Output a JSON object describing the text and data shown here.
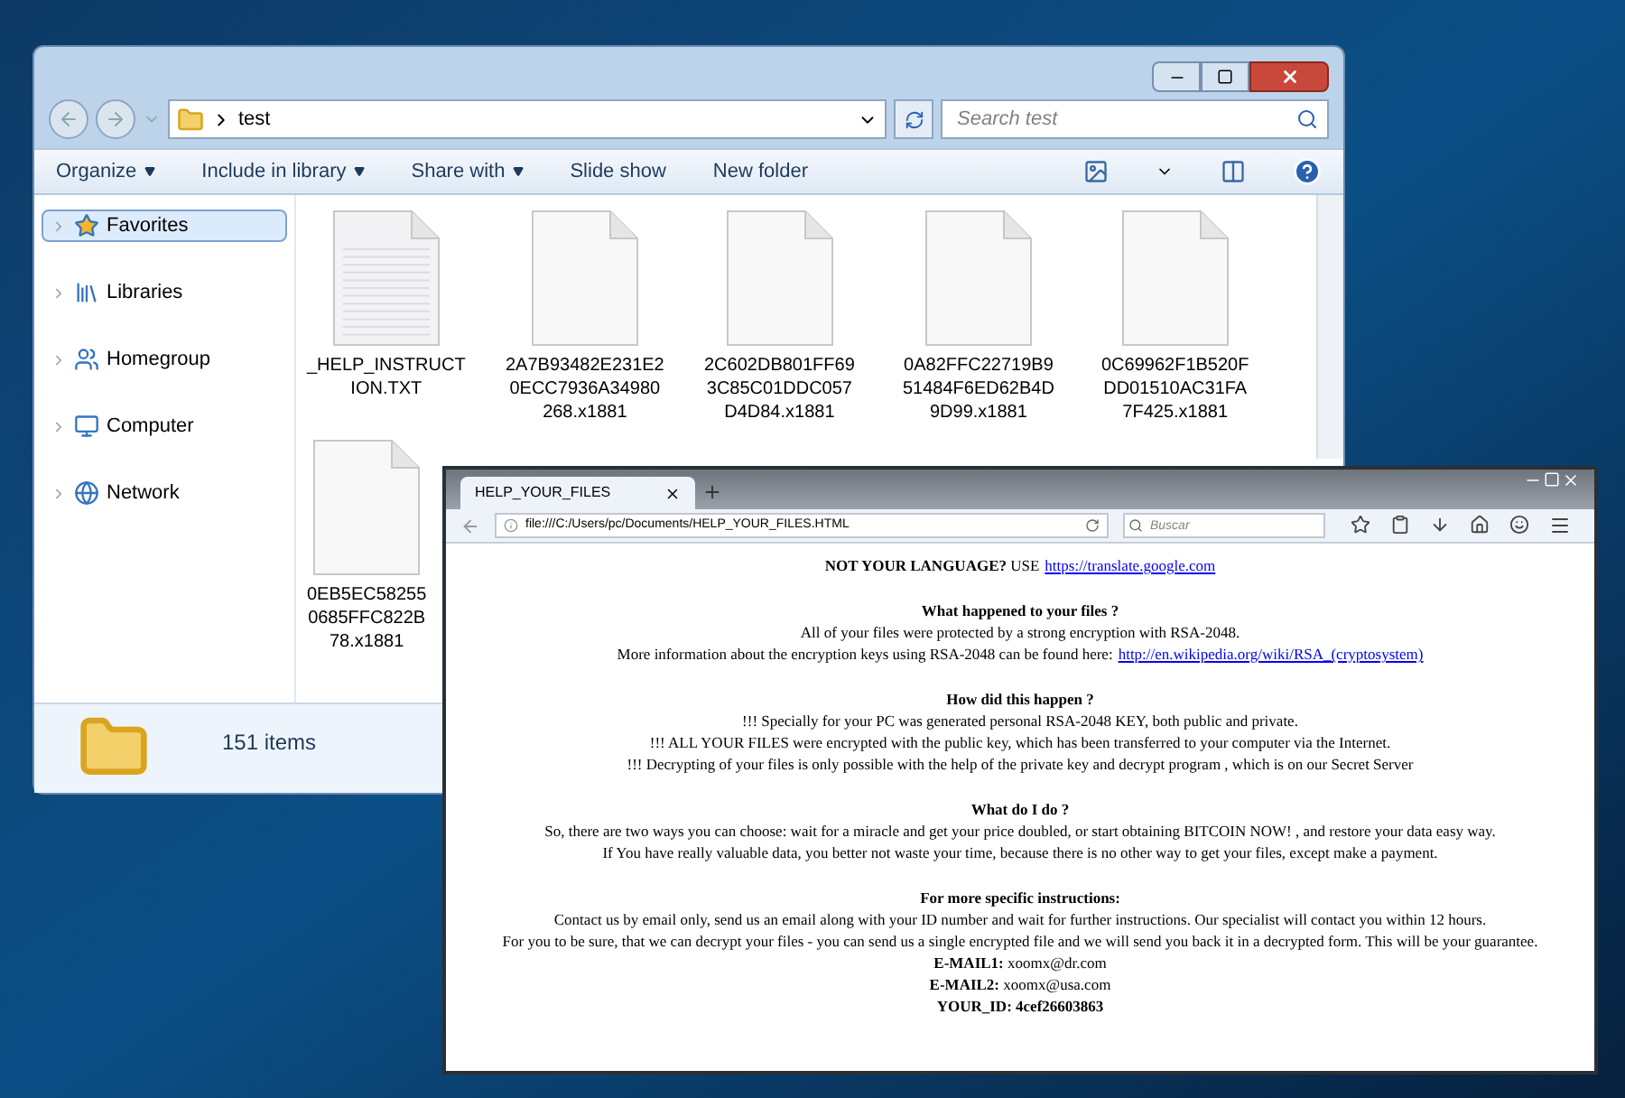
{
  "explorer": {
    "address": "test",
    "search": {
      "placeholder": "Search test"
    },
    "toolbar": [
      {
        "label": "Organize",
        "menu": true
      },
      {
        "label": "Include in library",
        "menu": true
      },
      {
        "label": "Share with",
        "menu": true
      },
      {
        "label": "Slide show",
        "menu": false
      },
      {
        "label": "New folder",
        "menu": false
      }
    ],
    "sidebar": {
      "items": [
        {
          "label": "Favorites",
          "selected": true,
          "kind": "star"
        },
        {
          "label": "Libraries",
          "selected": false,
          "kind": "library"
        },
        {
          "label": "Homegroup",
          "selected": false,
          "kind": "homegroup"
        },
        {
          "label": "Computer",
          "selected": false,
          "kind": "computer"
        },
        {
          "label": "Network",
          "selected": false,
          "kind": "network"
        }
      ]
    },
    "files": [
      {
        "name": "_HELP_INSTRUCT\nION.TXT",
        "kind": "text"
      },
      {
        "name": "2A7B93482E231E2\n0ECC7936A34980\n268.x1881",
        "kind": "data"
      },
      {
        "name": "2C602DB801FF69\n3C85C01DDC057\nD4D84.x1881",
        "kind": "data"
      },
      {
        "name": "0A82FFC22719B9\n51484F6ED62B4D\n9D99.x1881",
        "kind": "data"
      },
      {
        "name": "0C69962F1B520F\nDD01510AC31FA\n7F425.x1881",
        "kind": "data"
      },
      {
        "name": "0EB5EC58255\n0685FFC822B\n78.x1881",
        "kind": "data"
      }
    ],
    "status_bar": "151 items"
  },
  "browser": {
    "tab": {
      "title": "HELP_YOUR_FILES",
      "selected": true
    },
    "url": "file:///C:/Users/pc/Documents/HELP_YOUR_FILES.HTML",
    "search": {
      "placeholder": "Buscar"
    },
    "lines": [
      {
        "kind": "link",
        "text": "**NOT YOUR LANGUAGE?** USE",
        "link": "https://translate.google.com"
      },
      {
        "kind": "heading",
        "text": "What happened to your files ?"
      },
      {
        "kind": "text",
        "text": "All of your files were protected by a strong encryption with RSA-2048."
      },
      {
        "kind": "link",
        "text": "More information about the encryption keys using RSA-2048 can be found here:",
        "link": "http://en.wikipedia.org/wiki/RSA_(cryptosystem)"
      },
      {
        "kind": "heading",
        "text": "How did this happen ?"
      },
      {
        "kind": "text",
        "text": "!!! Specially for your PC was generated personal RSA-2048 KEY, both public and private."
      },
      {
        "kind": "text",
        "text": "!!! ALL YOUR FILES were encrypted with the public key, which has been transferred to your computer via the Internet."
      },
      {
        "kind": "text",
        "text": "!!! Decrypting of your files is only possible with the help of the private key and decrypt program , which is on our Secret Server"
      },
      {
        "kind": "heading",
        "text": "What do I do ?"
      },
      {
        "kind": "text",
        "text": "So, there are two ways you can choose: wait for a miracle and get your price doubled, or start obtaining BITCOIN NOW! , and restore your data easy way."
      },
      {
        "kind": "text",
        "text": "If You have really valuable data, you better not waste your time, because there is no other way to get your files, except make a payment."
      },
      {
        "kind": "heading",
        "text": "For more specific instructions:"
      },
      {
        "kind": "text",
        "text": "Contact us by email only, send us an email along with your ID number and wait for further instructions. Our specialist will contact you within 12 hours."
      },
      {
        "kind": "text",
        "text": "For you to be sure, that we can decrypt your files - you can send us a single encrypted file and we will send you back it in a decrypted form. This will be your guarantee."
      },
      {
        "kind": "text",
        "text": "**E-MAIL1:** xoomx@dr.com"
      },
      {
        "kind": "text",
        "text": "**E-MAIL2:** xoomx@usa.com"
      },
      {
        "kind": "bold",
        "text": "YOUR_ID: 4cef26603863"
      }
    ]
  }
}
